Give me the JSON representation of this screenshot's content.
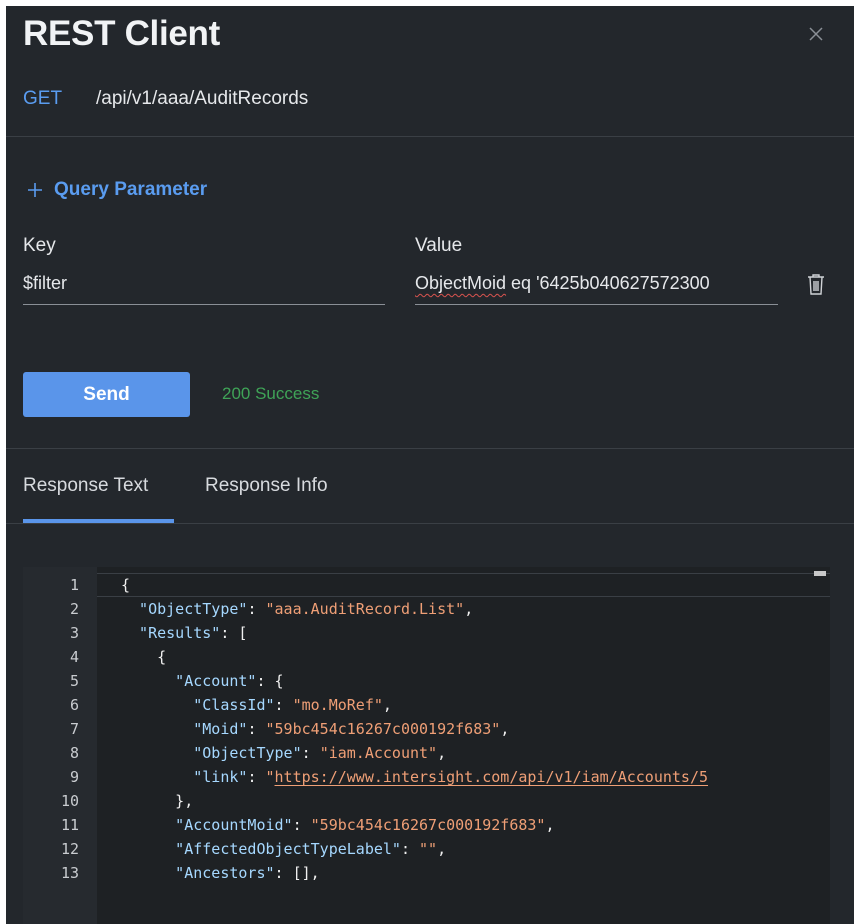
{
  "window": {
    "title": "REST Client",
    "close_icon": "close-icon"
  },
  "request": {
    "method": "GET",
    "path": "/api/v1/aaa/AuditRecords"
  },
  "query_parameter": {
    "add_label": "Query Parameter",
    "add_icon": "plus-icon",
    "key_label": "Key",
    "value_label": "Value",
    "key_value": "$filter",
    "value_value_part1": "ObjectMoid",
    "value_value_part2": " eq '6425b040627572300",
    "delete_icon": "trash-icon"
  },
  "actions": {
    "send_label": "Send",
    "status_text": "200 Success"
  },
  "tabs": [
    {
      "label": "Response Text",
      "active": true
    },
    {
      "label": "Response Info",
      "active": false
    }
  ],
  "response": {
    "lines": [
      {
        "n": "1",
        "tokens": [
          {
            "t": "p",
            "v": "{"
          }
        ]
      },
      {
        "n": "2",
        "tokens": [
          {
            "t": "k",
            "v": "  \"ObjectType\""
          },
          {
            "t": "p",
            "v": ": "
          },
          {
            "t": "s",
            "v": "\"aaa.AuditRecord.List\""
          },
          {
            "t": "p",
            "v": ","
          }
        ]
      },
      {
        "n": "3",
        "tokens": [
          {
            "t": "k",
            "v": "  \"Results\""
          },
          {
            "t": "p",
            "v": ": ["
          }
        ]
      },
      {
        "n": "4",
        "tokens": [
          {
            "t": "p",
            "v": "    {"
          }
        ]
      },
      {
        "n": "5",
        "tokens": [
          {
            "t": "k",
            "v": "      \"Account\""
          },
          {
            "t": "p",
            "v": ": {"
          }
        ]
      },
      {
        "n": "6",
        "tokens": [
          {
            "t": "k",
            "v": "        \"ClassId\""
          },
          {
            "t": "p",
            "v": ": "
          },
          {
            "t": "s",
            "v": "\"mo.MoRef\""
          },
          {
            "t": "p",
            "v": ","
          }
        ]
      },
      {
        "n": "7",
        "tokens": [
          {
            "t": "k",
            "v": "        \"Moid\""
          },
          {
            "t": "p",
            "v": ": "
          },
          {
            "t": "s",
            "v": "\"59bc454c16267c000192f683\""
          },
          {
            "t": "p",
            "v": ","
          }
        ]
      },
      {
        "n": "8",
        "tokens": [
          {
            "t": "k",
            "v": "        \"ObjectType\""
          },
          {
            "t": "p",
            "v": ": "
          },
          {
            "t": "s",
            "v": "\"iam.Account\""
          },
          {
            "t": "p",
            "v": ","
          }
        ]
      },
      {
        "n": "9",
        "tokens": [
          {
            "t": "k",
            "v": "        \"link\""
          },
          {
            "t": "p",
            "v": ": "
          },
          {
            "t": "s",
            "v": "\""
          },
          {
            "t": "su",
            "v": "https://www.intersight.com/api/v1/iam/Accounts/5"
          }
        ]
      },
      {
        "n": "10",
        "tokens": [
          {
            "t": "p",
            "v": "      },"
          }
        ]
      },
      {
        "n": "11",
        "tokens": [
          {
            "t": "k",
            "v": "      \"AccountMoid\""
          },
          {
            "t": "p",
            "v": ": "
          },
          {
            "t": "s",
            "v": "\"59bc454c16267c000192f683\""
          },
          {
            "t": "p",
            "v": ","
          }
        ]
      },
      {
        "n": "12",
        "tokens": [
          {
            "t": "k",
            "v": "      \"AffectedObjectTypeLabel\""
          },
          {
            "t": "p",
            "v": ": "
          },
          {
            "t": "s",
            "v": "\"\""
          },
          {
            "t": "p",
            "v": ","
          }
        ]
      },
      {
        "n": "13",
        "tokens": [
          {
            "t": "k",
            "v": "      \"Ancestors\""
          },
          {
            "t": "p",
            "v": ": [],"
          }
        ]
      }
    ]
  }
}
